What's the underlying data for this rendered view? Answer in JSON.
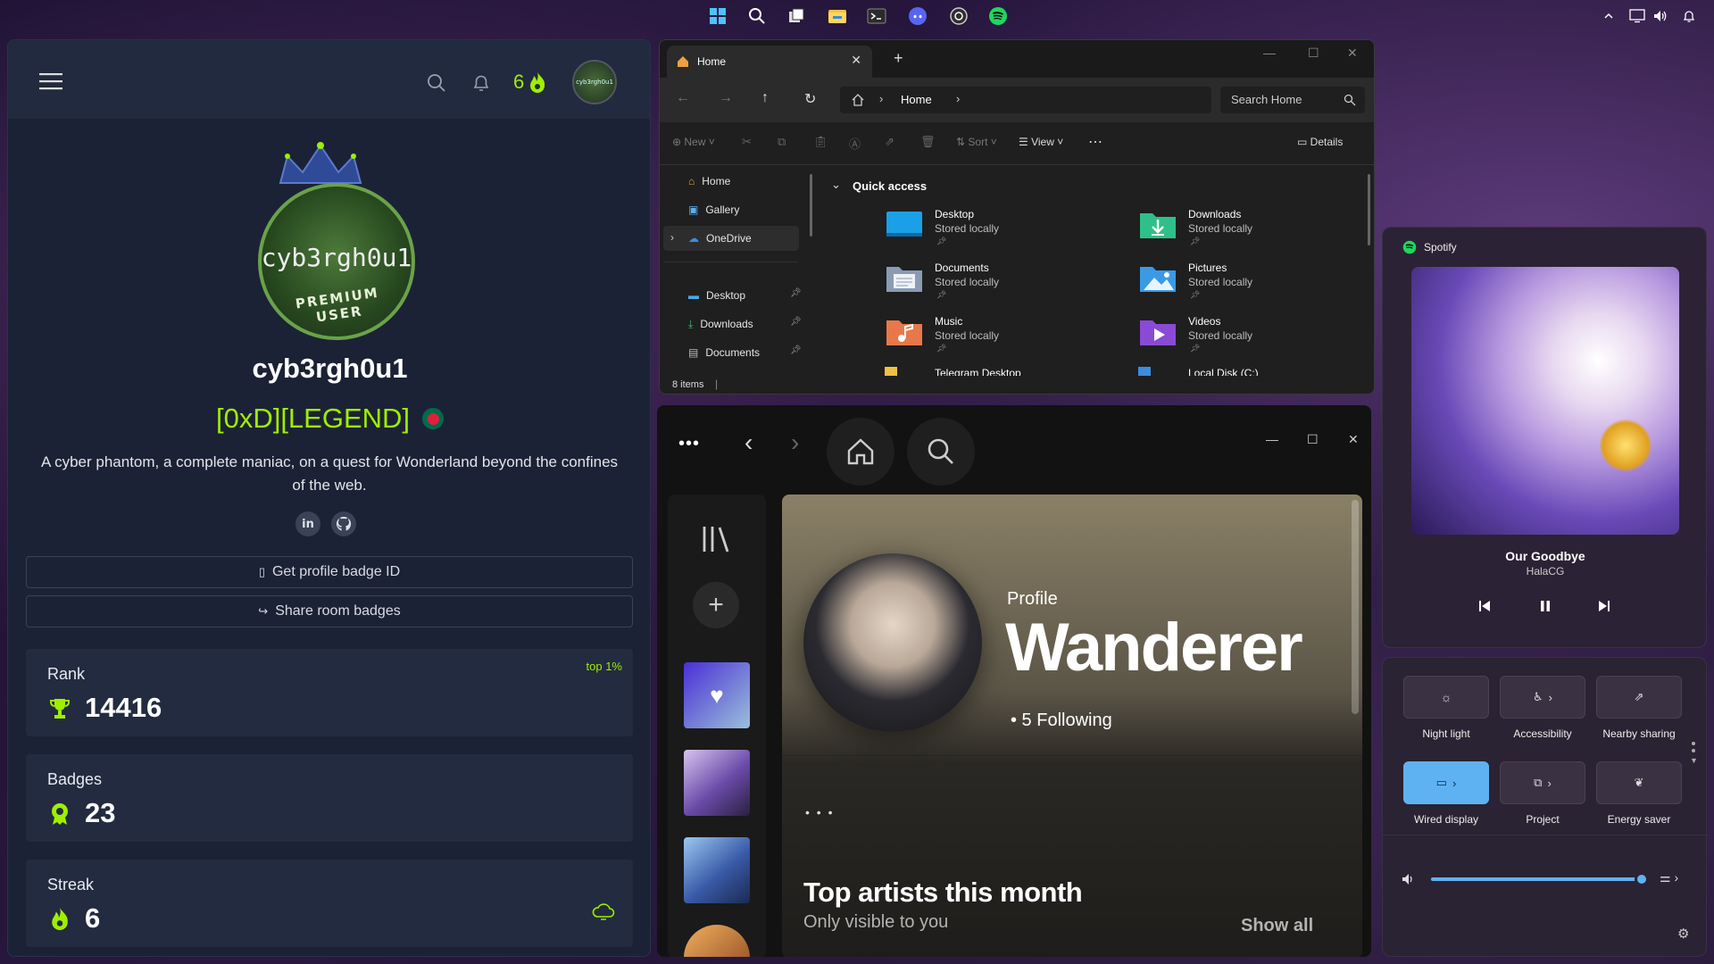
{
  "taskbar": {
    "icons": [
      "windows-start-icon",
      "search-icon",
      "task-view-icon",
      "file-explorer-icon",
      "terminal-icon",
      "discord-icon",
      "obs-icon",
      "spotify-icon"
    ],
    "tray": [
      "chevron-up-icon",
      "display-icon",
      "volume-icon",
      "bell-icon"
    ]
  },
  "thm": {
    "streak_count": "6",
    "avatar_small_text": "cyb3rgh0u1",
    "avatar_text": "cyb3rgh0u1",
    "avatar_ring": "PREMIUM USER",
    "username": "cyb3rgh0u1",
    "rank_title": "[0xD][LEGEND]",
    "bio": "A cyber phantom, a complete maniac, on a quest for Wonderland beyond the confines of the web.",
    "buttons": {
      "badge_id": "Get profile badge ID",
      "share": "Share room badges"
    },
    "rank": {
      "label": "Rank",
      "value": "14416",
      "tag": "top 1%"
    },
    "badges": {
      "label": "Badges",
      "value": "23"
    },
    "streak": {
      "label": "Streak",
      "value": "6"
    },
    "colors": {
      "accent": "#9fef00",
      "flag_red": "#e0203a",
      "flag_green": "#006a4e"
    }
  },
  "explorer": {
    "tab_title": "Home",
    "breadcrumb": "Home",
    "search_placeholder": "Search Home",
    "toolbar": {
      "new": "New",
      "sort": "Sort",
      "view": "View",
      "details": "Details"
    },
    "nav": {
      "home": "Home",
      "gallery": "Gallery",
      "onedrive": "OneDrive",
      "desktop": "Desktop",
      "downloads": "Downloads",
      "documents": "Documents"
    },
    "section": "Quick access",
    "items": [
      {
        "name": "Desktop",
        "status": "Stored locally"
      },
      {
        "name": "Downloads",
        "status": "Stored locally"
      },
      {
        "name": "Documents",
        "status": "Stored locally"
      },
      {
        "name": "Pictures",
        "status": "Stored locally"
      },
      {
        "name": "Music",
        "status": "Stored locally"
      },
      {
        "name": "Videos",
        "status": "Stored locally"
      }
    ],
    "partial_items": [
      "Telegram Desktop",
      "Local Disk (C:)"
    ],
    "status": "8 items"
  },
  "spotify": {
    "profile_label": "Profile",
    "profile_name": "Wanderer",
    "following": "• 5 Following",
    "dots": "• • •",
    "section_title": "Top artists this month",
    "section_sub": "Only visible to you",
    "show_all": "Show all"
  },
  "media": {
    "app": "Spotify",
    "track": "Our Goodbye",
    "artist": "HalaCG"
  },
  "quick": {
    "tiles": [
      "Night light",
      "Accessibility",
      "Nearby sharing",
      "Wired display",
      "Project",
      "Energy saver"
    ],
    "volume_percent": 100,
    "accent": "#5fb2f2"
  }
}
